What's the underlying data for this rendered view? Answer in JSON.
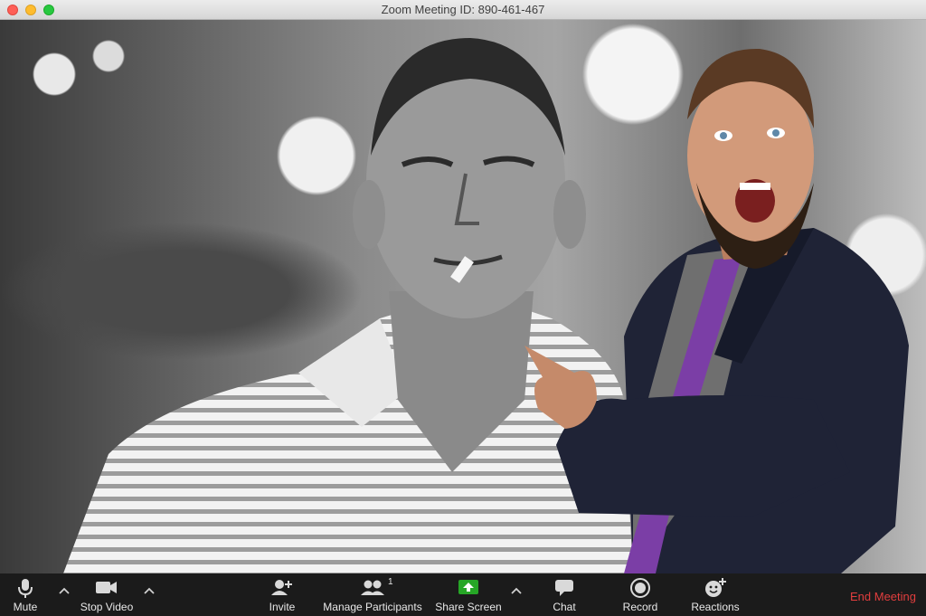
{
  "window": {
    "title": "Zoom Meeting ID: 890-461-467"
  },
  "toolbar": {
    "mute_label": "Mute",
    "stop_video_label": "Stop Video",
    "invite_label": "Invite",
    "manage_participants_label": "Manage Participants",
    "participant_count": "1",
    "share_screen_label": "Share Screen",
    "chat_label": "Chat",
    "record_label": "Record",
    "reactions_label": "Reactions",
    "end_meeting_label": "End Meeting"
  },
  "colors": {
    "toolbar_bg": "#1b1b1b",
    "share_screen_green": "#26a626",
    "end_meeting_red": "#e23e3e"
  },
  "icons": {
    "mute": "microphone-icon",
    "stop_video": "video-camera-icon",
    "invite": "add-person-icon",
    "manage_participants": "participants-icon",
    "share_screen": "share-screen-arrow-icon",
    "chat": "speech-bubble-icon",
    "record": "record-circle-icon",
    "reactions": "emoji-plus-icon"
  }
}
